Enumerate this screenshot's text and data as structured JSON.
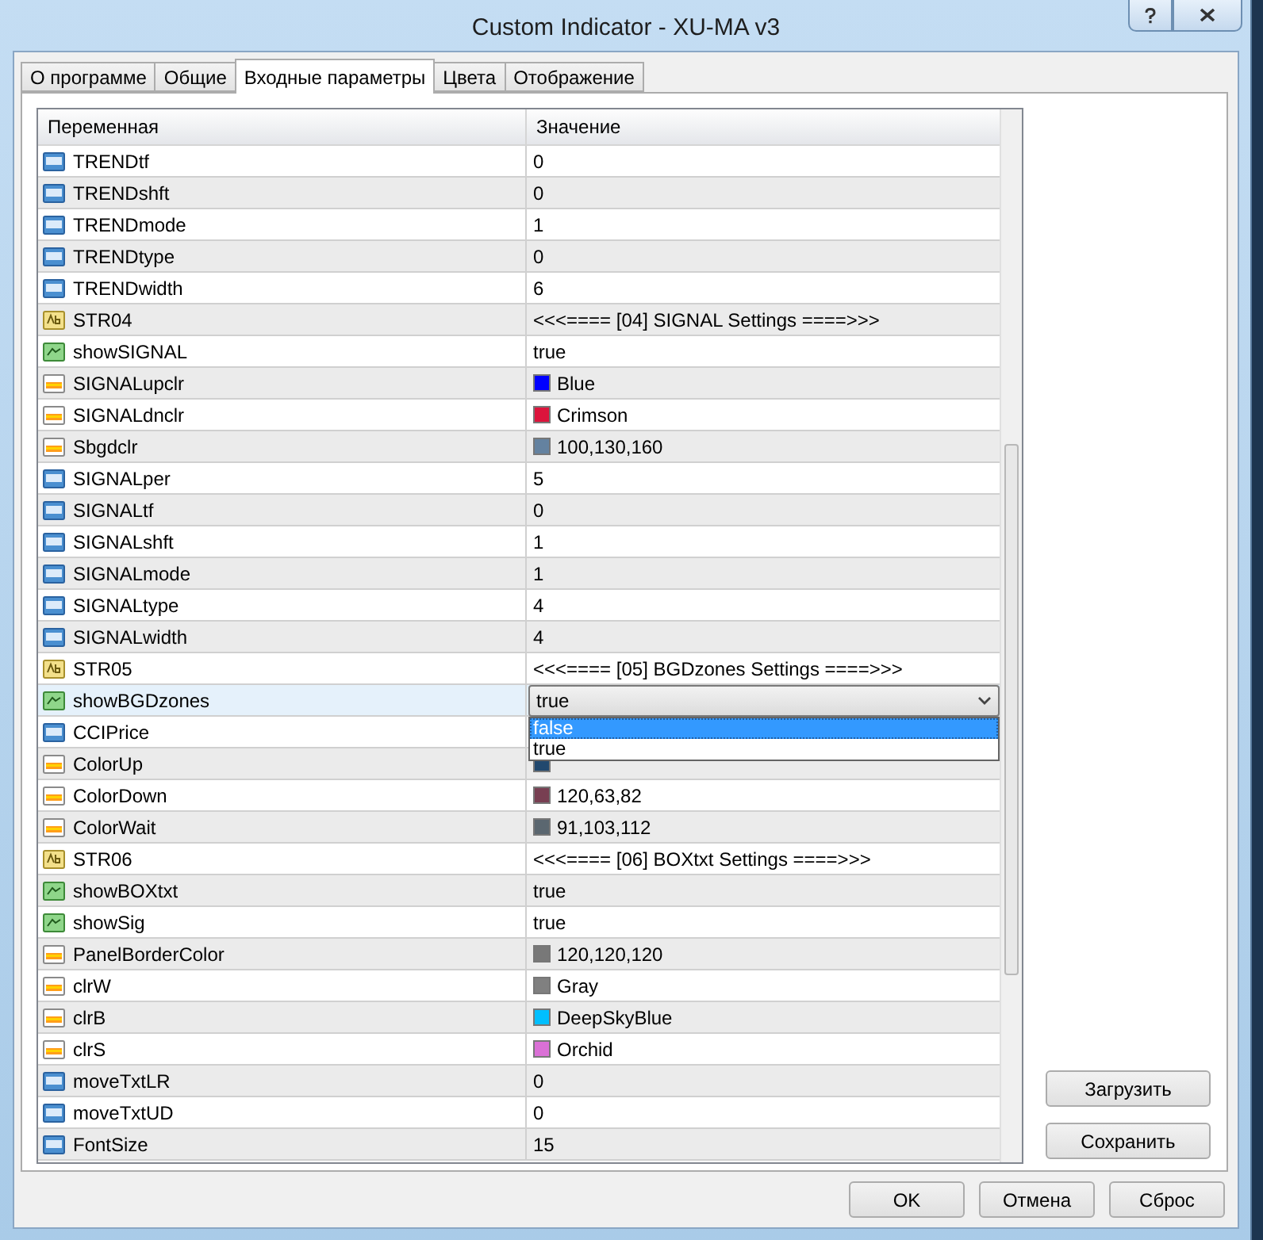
{
  "window": {
    "title": "Custom Indicator - XU-MA v3"
  },
  "tabs": [
    {
      "label": "О программе",
      "selected": false
    },
    {
      "label": "Общие",
      "selected": false
    },
    {
      "label": "Входные параметры",
      "selected": true
    },
    {
      "label": "Цвета",
      "selected": false
    },
    {
      "label": "Отображение",
      "selected": false
    }
  ],
  "table": {
    "columns": [
      "Переменная",
      "Значение"
    ],
    "rows": [
      {
        "name": "TRENDtf",
        "kind": "int",
        "value": "0",
        "selected": false
      },
      {
        "name": "TRENDshft",
        "kind": "int",
        "value": "0",
        "selected": false
      },
      {
        "name": "TRENDmode",
        "kind": "int",
        "value": "1",
        "selected": false
      },
      {
        "name": "TRENDtype",
        "kind": "int",
        "value": "0",
        "selected": false
      },
      {
        "name": "TRENDwidth",
        "kind": "int",
        "value": "6",
        "selected": false
      },
      {
        "name": "STR04",
        "kind": "string",
        "value": "<<<==== [04] SIGNAL Settings ====>>>",
        "selected": false
      },
      {
        "name": "showSIGNAL",
        "kind": "bool",
        "value": "true",
        "selected": false
      },
      {
        "name": "SIGNALupclr",
        "kind": "color",
        "value": "Blue",
        "color": "#0000ff",
        "selected": false
      },
      {
        "name": "SIGNALdnclr",
        "kind": "color",
        "value": "Crimson",
        "color": "#dc143c",
        "selected": false
      },
      {
        "name": "Sbgdclr",
        "kind": "color",
        "value": "100,130,160",
        "color": "#6482a0",
        "selected": false
      },
      {
        "name": "SIGNALper",
        "kind": "int",
        "value": "5",
        "selected": false
      },
      {
        "name": "SIGNALtf",
        "kind": "int",
        "value": "0",
        "selected": false
      },
      {
        "name": "SIGNALshft",
        "kind": "int",
        "value": "1",
        "selected": false
      },
      {
        "name": "SIGNALmode",
        "kind": "int",
        "value": "1",
        "selected": false
      },
      {
        "name": "SIGNALtype",
        "kind": "int",
        "value": "4",
        "selected": false
      },
      {
        "name": "SIGNALwidth",
        "kind": "int",
        "value": "4",
        "selected": false
      },
      {
        "name": "STR05",
        "kind": "string",
        "value": "<<<==== [05] BGDzones Settings ====>>>",
        "selected": false
      },
      {
        "name": "showBGDzones",
        "kind": "bool",
        "value": "true",
        "selected": true,
        "dropdown": {
          "expanded": true,
          "options": [
            {
              "label": "false",
              "selected": true
            },
            {
              "label": "true",
              "selected": false
            }
          ]
        }
      },
      {
        "name": "CCIPrice",
        "kind": "int",
        "selected": false
      },
      {
        "name": "ColorUp",
        "kind": "color",
        "color": "#21486e",
        "selected": false
      },
      {
        "name": "ColorDown",
        "kind": "color",
        "value": "120,63,82",
        "color": "#783f52",
        "selected": false
      },
      {
        "name": "ColorWait",
        "kind": "color",
        "value": "91,103,112",
        "color": "#5b6770",
        "selected": false
      },
      {
        "name": "STR06",
        "kind": "string",
        "value": "<<<==== [06] BOXtxt Settings ====>>>",
        "selected": false
      },
      {
        "name": "showBOXtxt",
        "kind": "bool",
        "value": "true",
        "selected": false
      },
      {
        "name": "showSig",
        "kind": "bool",
        "value": "true",
        "selected": false
      },
      {
        "name": "PanelBorderColor",
        "kind": "color",
        "value": "120,120,120",
        "color": "#787878",
        "selected": false
      },
      {
        "name": "clrW",
        "kind": "color",
        "value": "Gray",
        "color": "#808080",
        "selected": false
      },
      {
        "name": "clrB",
        "kind": "color",
        "value": "DeepSkyBlue",
        "color": "#00bfff",
        "selected": false
      },
      {
        "name": "clrS",
        "kind": "color",
        "value": "Orchid",
        "color": "#da70d6",
        "selected": false
      },
      {
        "name": "moveTxtLR",
        "kind": "int",
        "value": "0",
        "selected": false
      },
      {
        "name": "moveTxtUD",
        "kind": "int",
        "value": "0",
        "selected": false
      },
      {
        "name": "FontSize",
        "kind": "int",
        "value": "15",
        "selected": false
      }
    ]
  },
  "side_buttons": [
    "Загрузить",
    "Сохранить"
  ],
  "buttons": [
    "OK",
    "Отмена",
    "Сброс"
  ]
}
